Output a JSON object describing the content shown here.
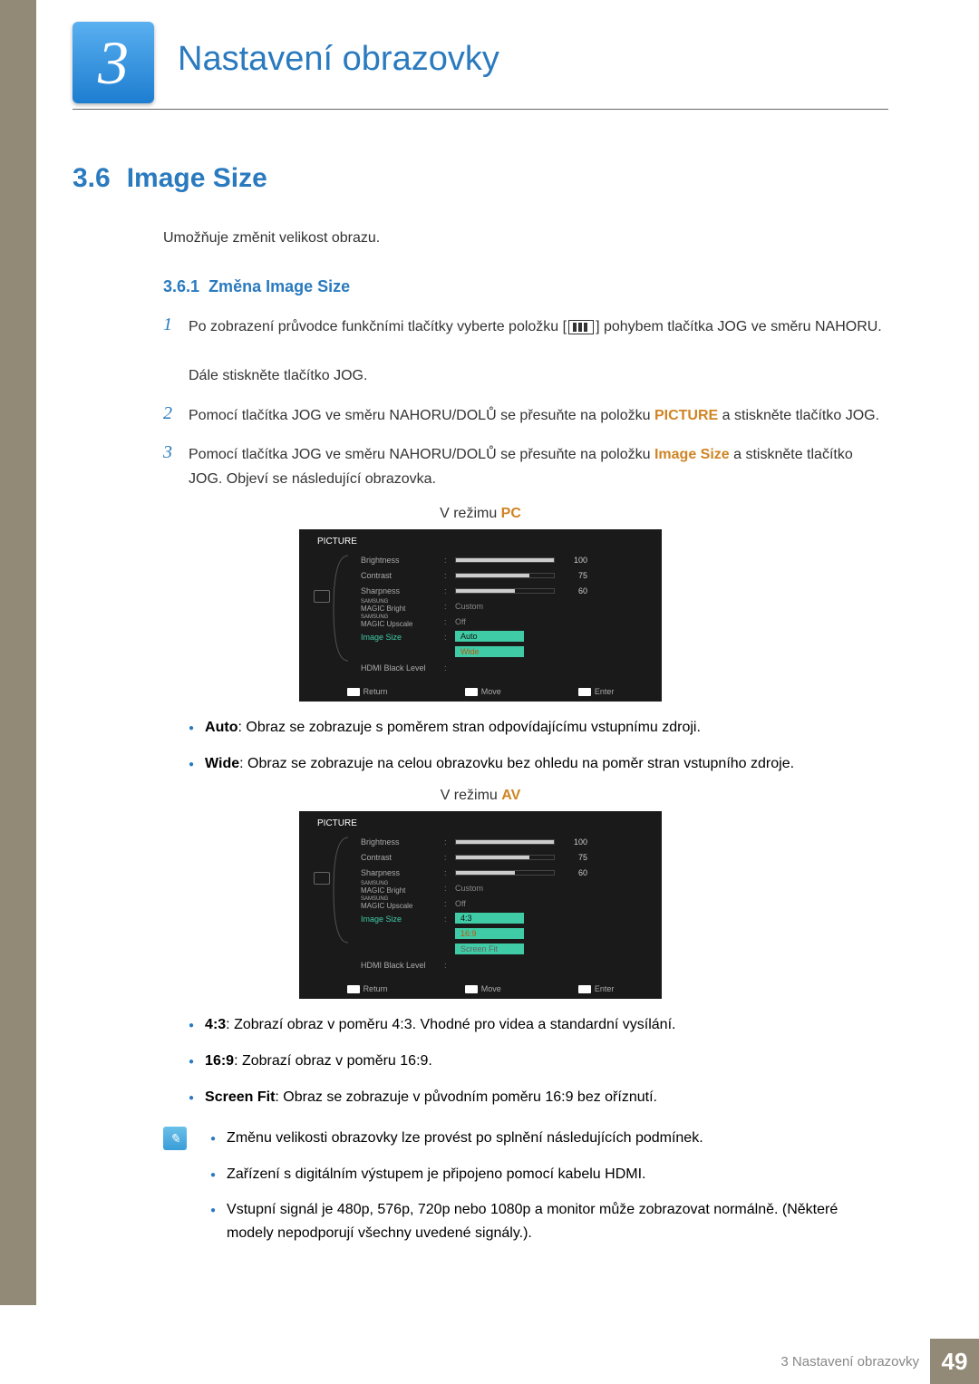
{
  "chapter": {
    "number": "3",
    "title": "Nastavení obrazovky"
  },
  "section": {
    "number": "3.6",
    "title": "Image Size",
    "desc": "Umožňuje změnit velikost obrazu."
  },
  "sub": {
    "number": "3.6.1",
    "title": "Změna Image Size"
  },
  "steps": {
    "s1": {
      "n": "1",
      "text_a": "Po zobrazení průvodce funkčními tlačítky vyberte položku [",
      "text_b": "] pohybem tlačítka JOG ve směru NAHORU.",
      "text_c": "Dále stiskněte tlačítko JOG."
    },
    "s2": {
      "n": "2",
      "text_a": "Pomocí tlačítka JOG ve směru NAHORU/DOLŮ se přesuňte na položku ",
      "hl": "PICTURE",
      "text_b": " a stiskněte tlačítko JOG."
    },
    "s3": {
      "n": "3",
      "text_a": "Pomocí tlačítka JOG ve směru NAHORU/DOLŮ se přesuňte na položku ",
      "hl": "Image Size",
      "text_b": " a stiskněte tlačítko JOG. Objeví se následující obrazovka."
    }
  },
  "mode_pc": {
    "prefix": "V režimu ",
    "hl": "PC"
  },
  "mode_av": {
    "prefix": "V režimu ",
    "hl": "AV"
  },
  "osd": {
    "title": "PICTURE",
    "brightness": {
      "label": "Brightness",
      "value": 100,
      "pct": 100
    },
    "contrast": {
      "label": "Contrast",
      "value": 75,
      "pct": 75
    },
    "sharpness": {
      "label": "Sharpness",
      "value": 60,
      "pct": 60
    },
    "magic_bright": {
      "label": "Bright",
      "prefix": "MAGIC",
      "brand": "SAMSUNG",
      "value": "Custom"
    },
    "magic_upscale": {
      "label": "Upscale",
      "prefix": "MAGIC",
      "brand": "SAMSUNG",
      "value": "Off"
    },
    "image_size": {
      "label": "Image Size"
    },
    "hdmi": {
      "label": "HDMI Black Level"
    },
    "opts_pc": [
      "Auto",
      "Wide"
    ],
    "opts_av": [
      "4:3",
      "16:9",
      "Screen Fit"
    ],
    "footer": {
      "return": "Return",
      "move": "Move",
      "enter": "Enter"
    }
  },
  "bullets_pc": [
    {
      "b": "Auto",
      "t": ": Obraz se zobrazuje s poměrem stran odpovídajícímu vstupnímu zdroji."
    },
    {
      "b": "Wide",
      "t": ": Obraz se zobrazuje na celou obrazovku bez ohledu na poměr stran vstupního zdroje."
    }
  ],
  "bullets_av": [
    {
      "b": "4:3",
      "t": ": Zobrazí obraz v poměru 4:3. Vhodné pro videa a standardní vysílání."
    },
    {
      "b": "16:9",
      "t": ": Zobrazí obraz v poměru 16:9."
    },
    {
      "b": "Screen Fit",
      "t": ": Obraz se zobrazuje v původním poměru 16:9 bez oříznutí."
    }
  ],
  "notes": [
    "Změnu velikosti obrazovky lze provést po splnění následujících podmínek.",
    "Zařízení s digitálním výstupem je připojeno pomocí kabelu HDMI.",
    "Vstupní signál je 480p, 576p, 720p nebo 1080p a monitor může zobrazovat normálně. (Některé modely nepodporují všechny uvedené signály.)."
  ],
  "footer": {
    "text": "3 Nastavení obrazovky",
    "page": "49"
  }
}
